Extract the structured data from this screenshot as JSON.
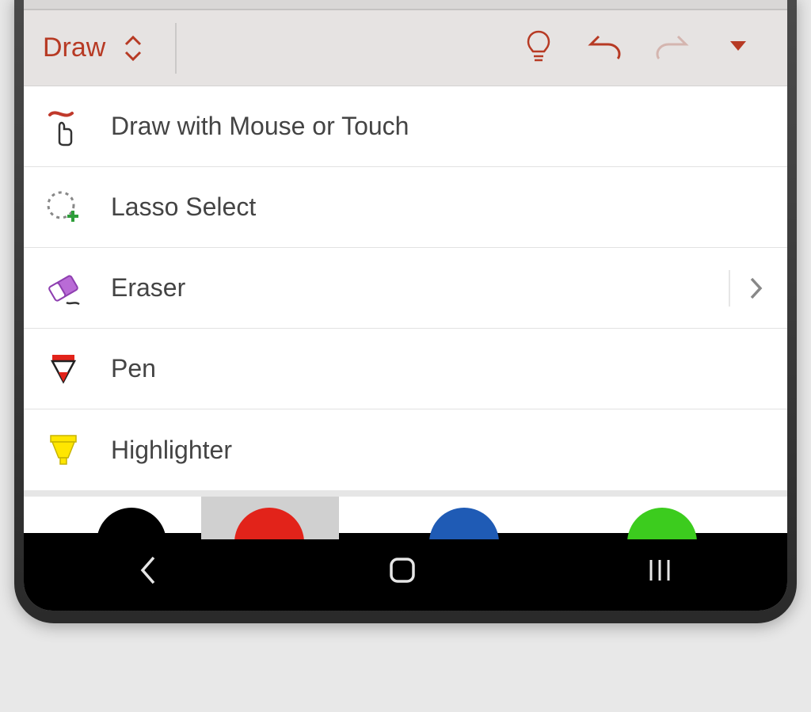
{
  "toolbar": {
    "tab_label": "Draw"
  },
  "menu": {
    "items": [
      {
        "label": "Draw with Mouse or Touch",
        "has_chevron": false
      },
      {
        "label": "Lasso Select",
        "has_chevron": false
      },
      {
        "label": "Eraser",
        "has_chevron": true
      },
      {
        "label": "Pen",
        "has_chevron": false
      },
      {
        "label": "Highlighter",
        "has_chevron": false
      }
    ]
  },
  "colors": {
    "swatches": [
      "black",
      "red",
      "blue",
      "green"
    ],
    "selected_index": 1
  },
  "theme": {
    "accent": "#b73a24"
  }
}
